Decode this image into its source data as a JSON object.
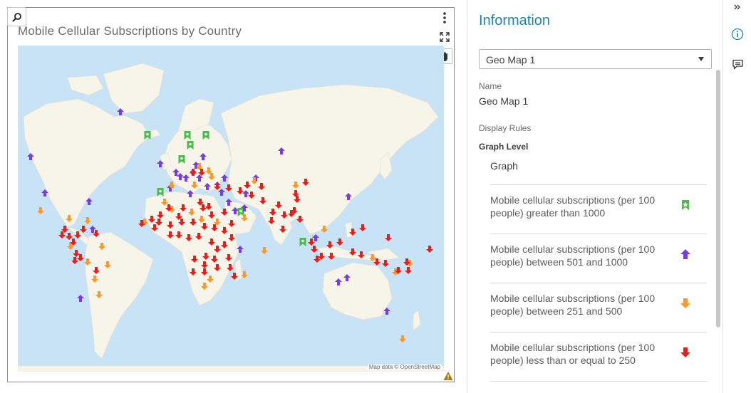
{
  "map": {
    "title": "Mobile Cellular Subscriptions by Country",
    "attribution": "Map data © OpenStreetMap",
    "colors": {
      "ocean": "#c9e3f6",
      "land": "#f7f4ea",
      "greater_1000": "#4cba4c",
      "501_1000": "#7a3ce0",
      "251_500": "#f59a2e",
      "le_250": "#e0221f"
    }
  },
  "info": {
    "title": "Information",
    "selector_value": "Geo Map 1",
    "name_label": "Name",
    "name_value": "Geo Map 1",
    "display_rules_label": "Display Rules",
    "graph_level_label": "Graph Level",
    "graph_label": "Graph",
    "rules": [
      {
        "text": "Mobile cellular subscriptions (per 100 people) greater than 1000",
        "icon": "green-star-marker-icon"
      },
      {
        "text": "Mobile cellular subscriptions (per 100 people) between 501 and 1000",
        "icon": "purple-up-arrow-icon"
      },
      {
        "text": "Mobile cellular subscriptions (per 100 people) between 251 and 500",
        "icon": "orange-down-arrow-icon"
      },
      {
        "text": "Mobile cellular subscriptions (per 100 people) less than or equal to 250",
        "icon": "red-down-arrow-icon"
      }
    ]
  },
  "rail": {
    "icons": [
      "collapse-panel-icon",
      "information-icon",
      "comment-icon"
    ]
  }
}
